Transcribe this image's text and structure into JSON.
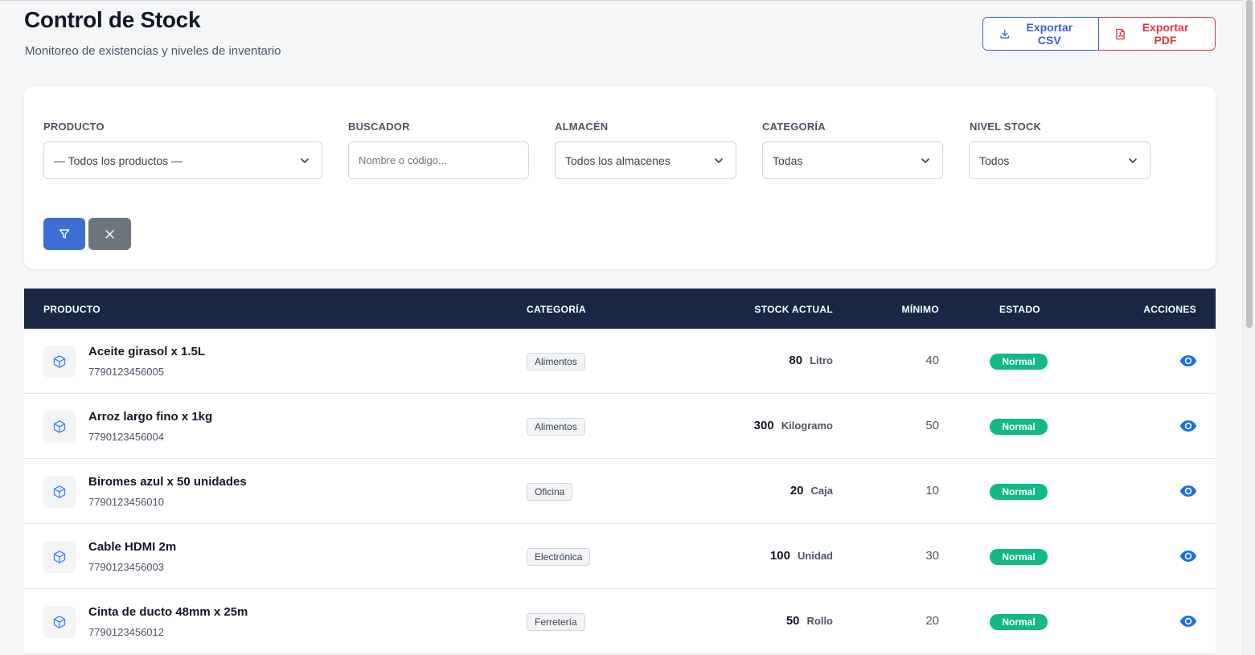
{
  "header": {
    "title": "Control de Stock",
    "subtitle": "Monitoreo de existencias y niveles de inventario",
    "export_csv": "Exportar CSV",
    "export_pdf": "Exportar PDF"
  },
  "filters": {
    "producto": {
      "label": "PRODUCTO",
      "value": "— Todos los productos —"
    },
    "buscador": {
      "label": "BUSCADOR",
      "placeholder": "Nombre o código..."
    },
    "almacen": {
      "label": "ALMACÉN",
      "value": "Todos los almacenes"
    },
    "categoria": {
      "label": "CATEGORÍA",
      "value": "Todas"
    },
    "nivel_stock": {
      "label": "NIVEL STOCK",
      "value": "Todos"
    }
  },
  "table": {
    "columns": {
      "producto": "PRODUCTO",
      "categoria": "CATEGORÍA",
      "stock_actual": "STOCK ACTUAL",
      "minimo": "MÍNIMO",
      "estado": "ESTADO",
      "acciones": "ACCIONES"
    },
    "rows": [
      {
        "name": "Aceite girasol x 1.5L",
        "code": "7790123456005",
        "category": "Alimentos",
        "qty": "80",
        "unit": "Litro",
        "min": "40",
        "status": "Normal"
      },
      {
        "name": "Arroz largo fino x 1kg",
        "code": "7790123456004",
        "category": "Alimentos",
        "qty": "300",
        "unit": "Kilogramo",
        "min": "50",
        "status": "Normal"
      },
      {
        "name": "Biromes azul x 50 unidades",
        "code": "7790123456010",
        "category": "Oficina",
        "qty": "20",
        "unit": "Caja",
        "min": "10",
        "status": "Normal"
      },
      {
        "name": "Cable HDMI 2m",
        "code": "7790123456003",
        "category": "Electrónica",
        "qty": "100",
        "unit": "Unidad",
        "min": "30",
        "status": "Normal"
      },
      {
        "name": "Cinta de ducto 48mm x 25m",
        "code": "7790123456012",
        "category": "Ferretería",
        "qty": "50",
        "unit": "Rollo",
        "min": "20",
        "status": "Normal"
      }
    ]
  },
  "colors": {
    "primary": "#3b6fd4",
    "danger": "#dc3545",
    "header_bg": "#1a2744",
    "success": "#12b886"
  },
  "icons": [
    "download-icon",
    "pdf-file-icon",
    "chevron-down-icon",
    "filter-icon",
    "close-icon",
    "box-icon",
    "eye-icon"
  ]
}
